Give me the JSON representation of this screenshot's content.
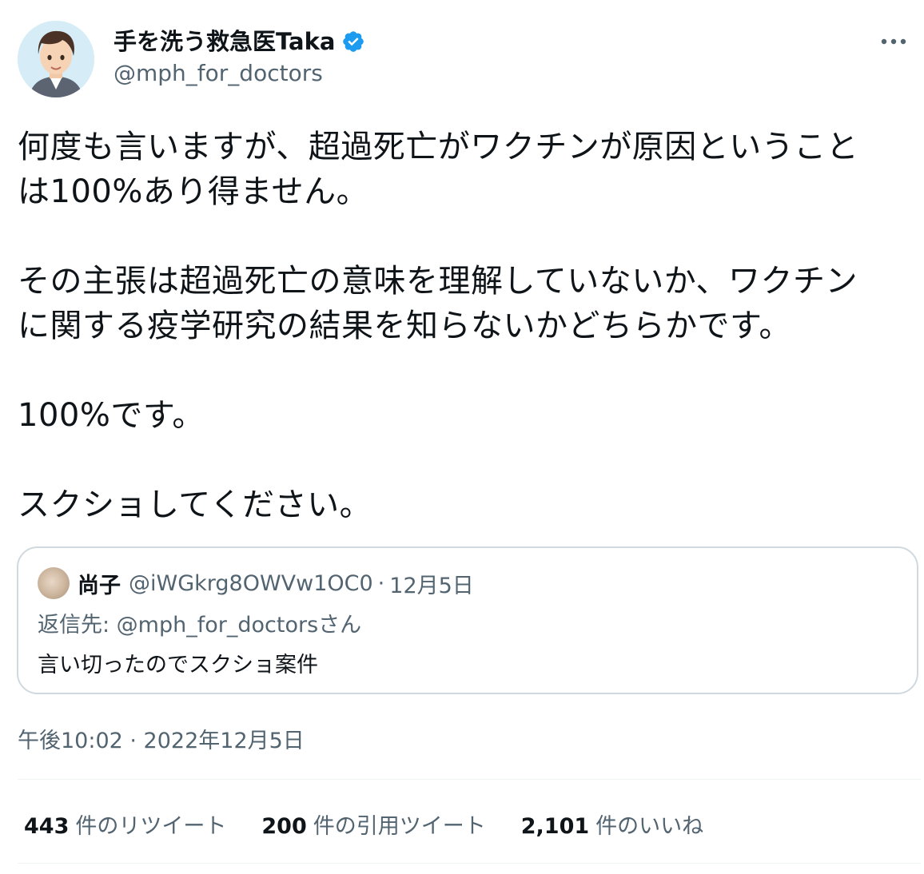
{
  "author": {
    "display_name": "手を洗う救急医Taka",
    "handle": "@mph_for_doctors",
    "verified_icon": "verified-badge-icon",
    "more_icon": "more-options-icon"
  },
  "tweet": {
    "lines": [
      "何度も言いますが、超過死亡がワクチンが原因ということ",
      "は100%あり得ません。",
      "",
      "その主張は超過死亡の意味を理解していないか、ワクチン",
      "に関する疫学研究の結果を知らないかどちらかです。",
      "",
      "100%です。",
      "",
      "スクショしてください。"
    ],
    "timestamp": "午後10:02 · 2022年12月5日"
  },
  "quote": {
    "name": "尚子",
    "handle": "@iWGkrg8OWVw1OC0",
    "dot": "·",
    "date": "12月5日",
    "reply_to": "返信先: @mph_for_doctorsさん",
    "text": "言い切ったのでスクショ案件"
  },
  "stats": {
    "retweets": {
      "count": "443",
      "label": "件のリツイート"
    },
    "quotes": {
      "count": "200",
      "label": "件の引用ツイート"
    },
    "likes": {
      "count": "2,101",
      "label": "件のいいね"
    }
  },
  "colors": {
    "text": "#0f1419",
    "secondary": "#536471",
    "verified": "#1d9bf0",
    "border": "#cfd9de"
  }
}
